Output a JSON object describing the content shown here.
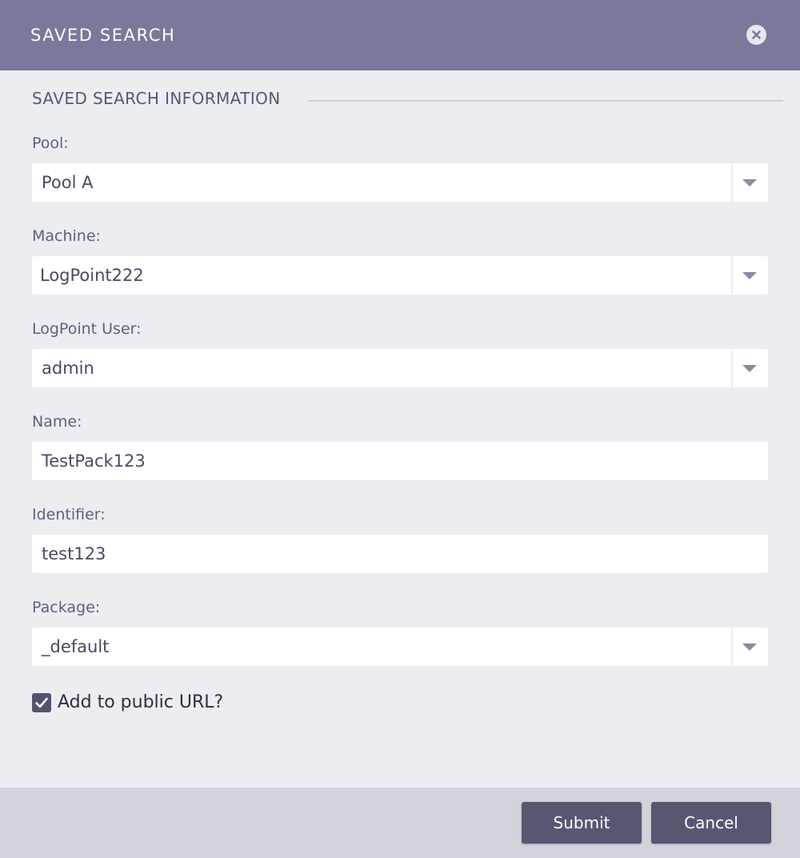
{
  "header": {
    "title": "SAVED SEARCH"
  },
  "section": {
    "title": "SAVED SEARCH INFORMATION"
  },
  "fields": {
    "pool": {
      "label": "Pool:",
      "value": "Pool A"
    },
    "machine": {
      "label": "Machine:",
      "value": "LogPoint222"
    },
    "logpoint_user": {
      "label": "LogPoint User:",
      "value": "admin"
    },
    "name": {
      "label": "Name:",
      "value": "TestPack123"
    },
    "identifier": {
      "label": "Identifier:",
      "value": "test123"
    },
    "package": {
      "label": "Package:",
      "value": "_default"
    }
  },
  "public_url": {
    "label": "Add to public URL?",
    "checked": true
  },
  "footer": {
    "submit_label": "Submit",
    "cancel_label": "Cancel"
  },
  "colors": {
    "header_bg": "#79799b",
    "body_bg": "#ecedf1",
    "footer_bg": "#d2d3db",
    "button_bg": "#575772"
  }
}
